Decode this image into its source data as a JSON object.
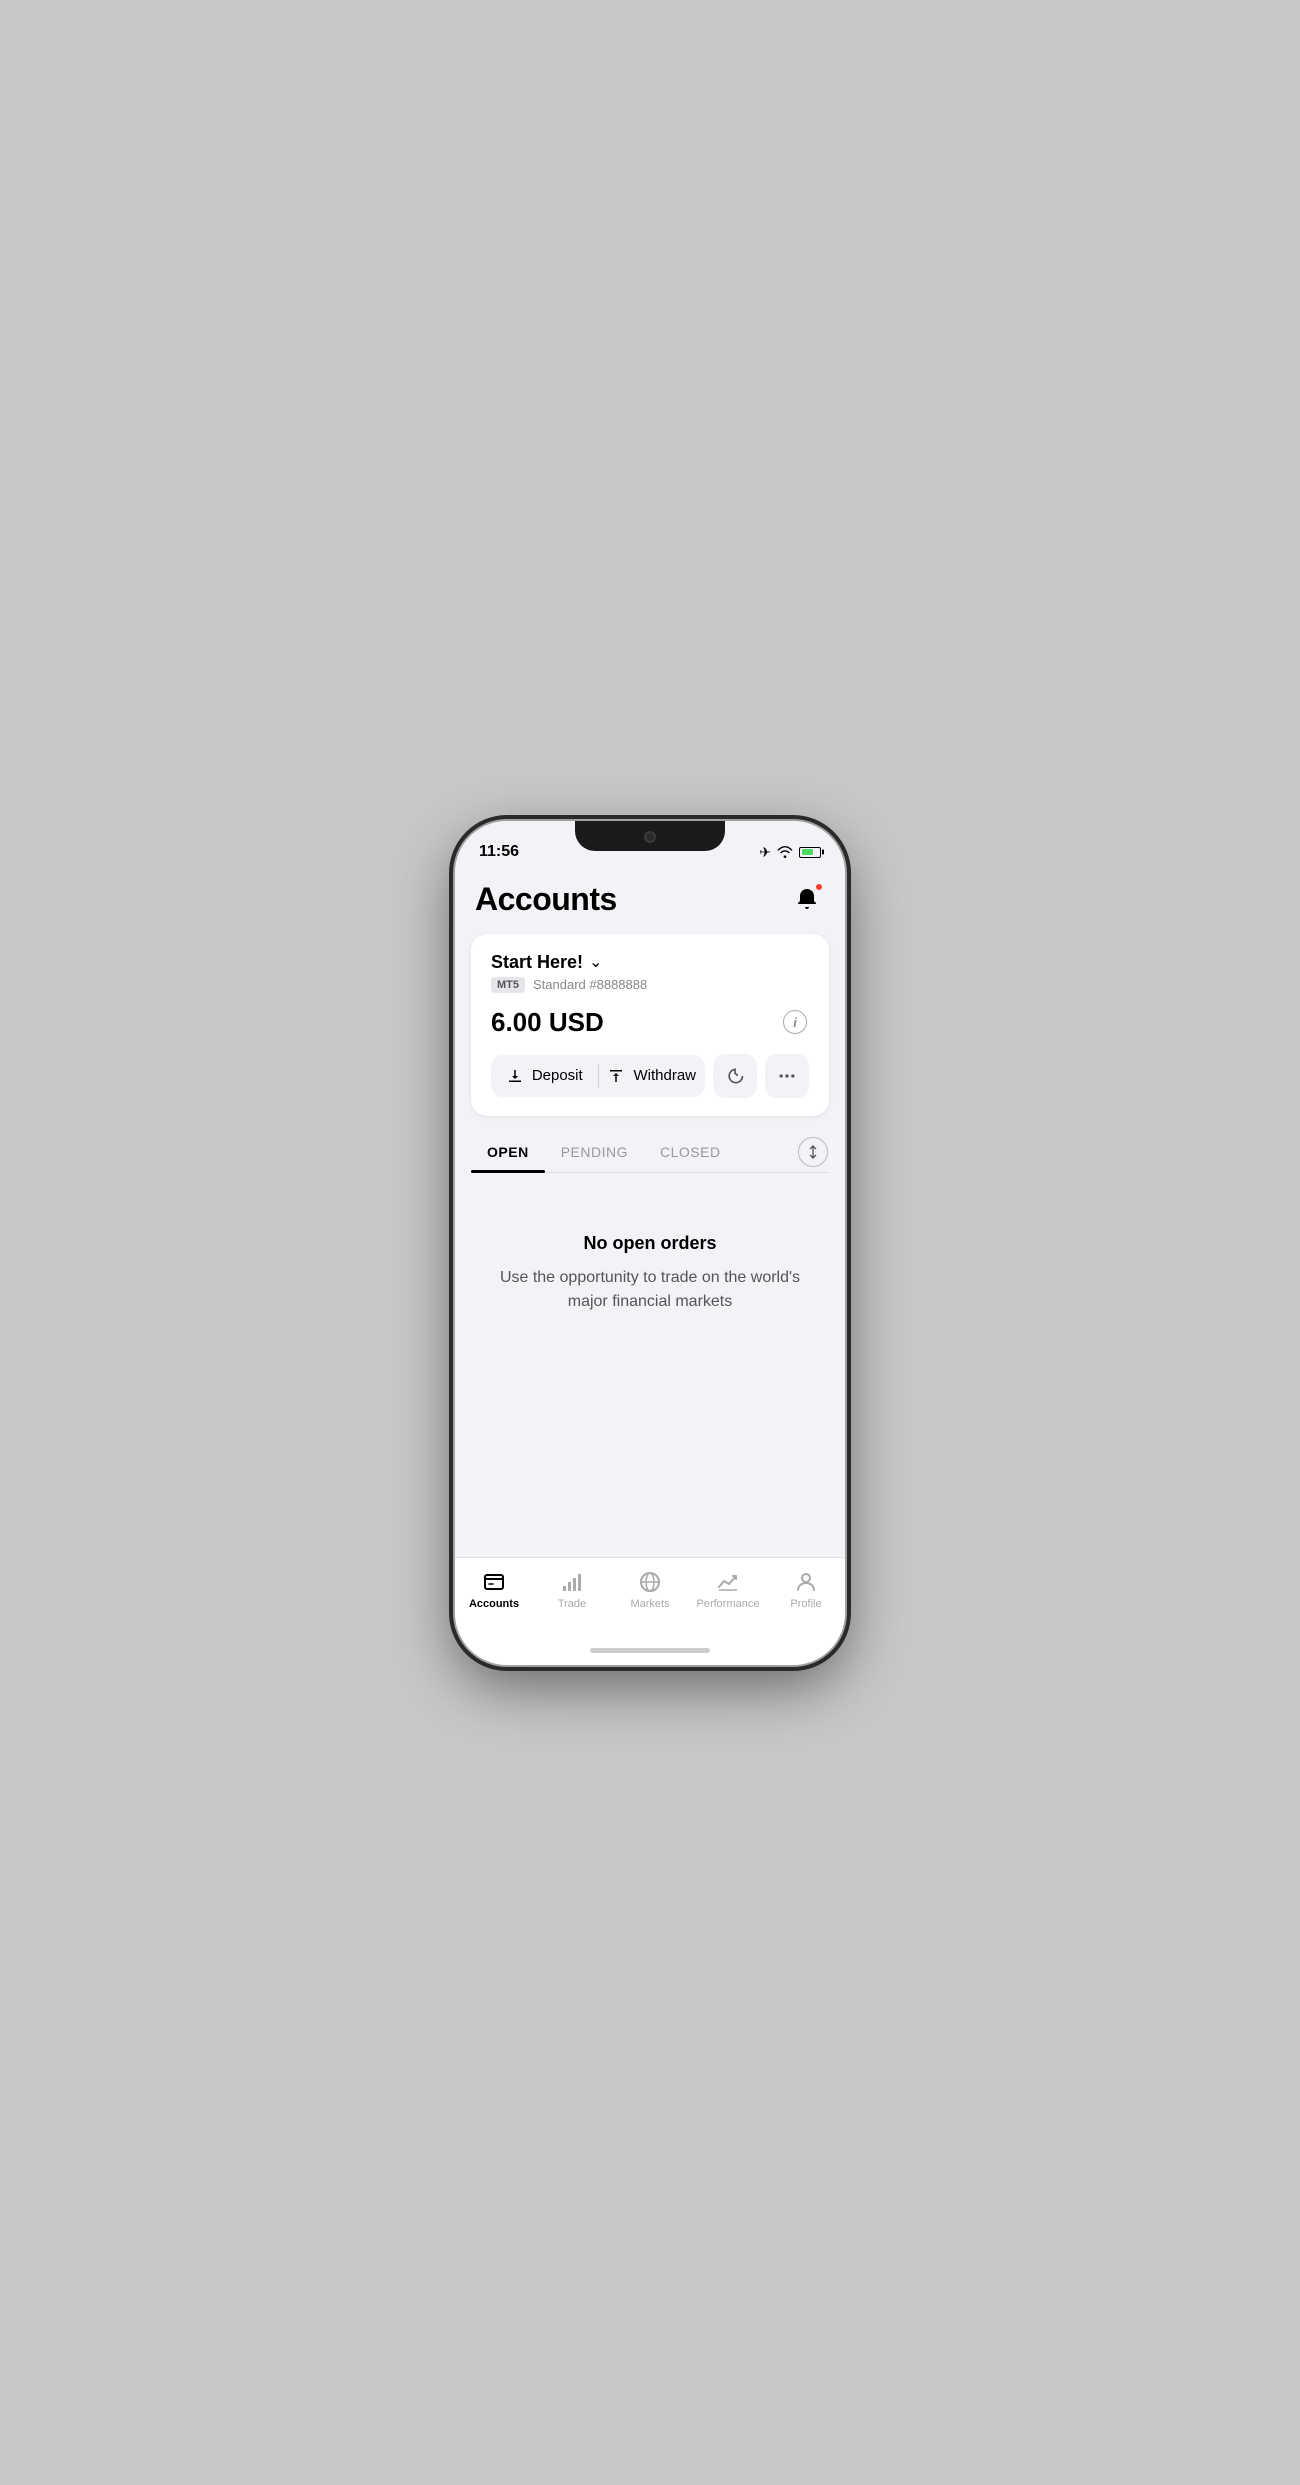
{
  "status_bar": {
    "time": "11:56",
    "airplane_mode": true,
    "wifi": true,
    "battery_level": "70"
  },
  "header": {
    "title": "Accounts",
    "notification_dot": true
  },
  "account_card": {
    "name": "Start Here!",
    "account_type": "MT5",
    "account_label": "Standard #8888888",
    "balance": "6.00 USD",
    "deposit_label": "Deposit",
    "withdraw_label": "Withdraw"
  },
  "tabs": {
    "open_label": "OPEN",
    "pending_label": "PENDING",
    "closed_label": "CLOSED",
    "active": "OPEN"
  },
  "empty_state": {
    "title": "No open orders",
    "description": "Use the opportunity to trade on the world's major financial markets"
  },
  "bottom_nav": {
    "items": [
      {
        "id": "accounts",
        "label": "Accounts",
        "active": true
      },
      {
        "id": "trade",
        "label": "Trade",
        "active": false
      },
      {
        "id": "markets",
        "label": "Markets",
        "active": false
      },
      {
        "id": "performance",
        "label": "Performance",
        "active": false
      },
      {
        "id": "profile",
        "label": "Profile",
        "active": false
      }
    ]
  },
  "colors": {
    "active": "#000000",
    "inactive": "#aaaaaa",
    "accent": "#ff3b30",
    "background": "#f2f2f7",
    "card": "#ffffff"
  }
}
